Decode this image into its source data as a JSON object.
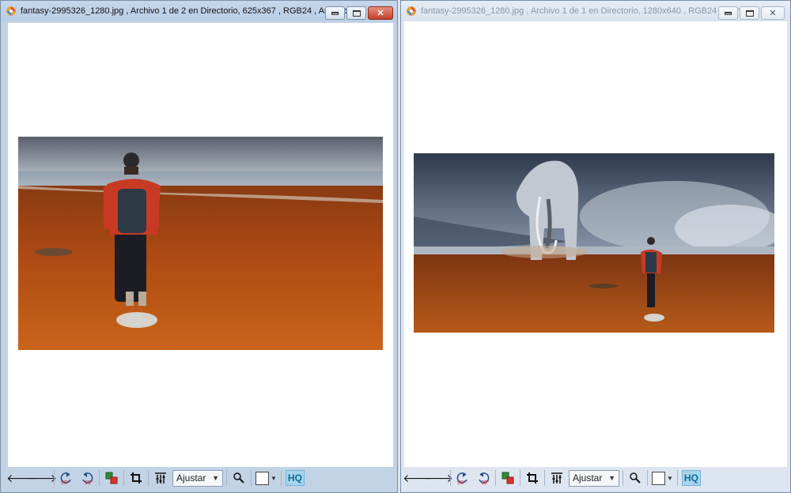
{
  "windows": [
    {
      "title": "fantasy-2995326_1280.jpg , Archivo 1 de 2 en Directorio, 625x367 , RGB24 , Archivo: 2...",
      "image_alt": "hiker-with-backpack-on-beach",
      "zoom_label": "Ajustar",
      "hq_label": "HQ",
      "rotate_left_label": "90°",
      "rotate_right_label": "90°"
    },
    {
      "title": "fantasy-2995326_1280.jpg , Archivo 1 de 1 en Directorio, 1280x640 , RGB24 , Archivo: ...",
      "image_alt": "hiker-and-giant-mammoth-on-beach",
      "zoom_label": "Ajustar",
      "hq_label": "HQ",
      "rotate_left_label": "90°",
      "rotate_right_label": "90°"
    }
  ],
  "icons": [
    "app-icon",
    "minimize-icon",
    "maximize-icon",
    "close-icon",
    "arrow-left-icon",
    "arrow-right-icon",
    "rotate-left-icon",
    "rotate-right-icon",
    "compare-icon",
    "crop-icon",
    "adjust-icon",
    "zoom-icon",
    "color-picker-icon"
  ],
  "colors": {
    "active_title": "#c3d3e6",
    "inactive_title": "#dde6f0",
    "close_button": "#c2402a",
    "hq_badge": "#a7d5ec"
  }
}
